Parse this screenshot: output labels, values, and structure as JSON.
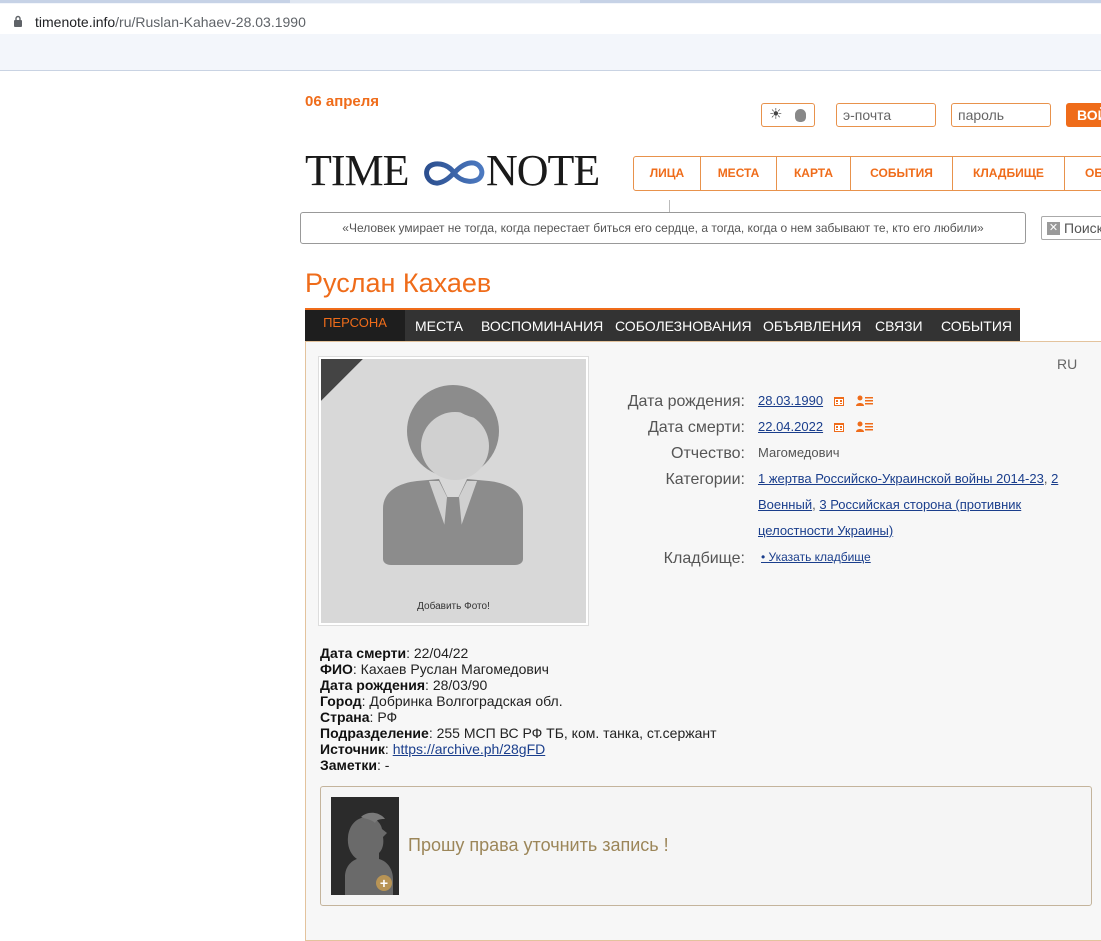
{
  "browser": {
    "url_host": "timenote.info",
    "url_path": "/ru/Ruslan-Kahaev-28.03.1990"
  },
  "header": {
    "date_today": "06 апреля",
    "email_placeholder": "э-почта",
    "password_placeholder": "пароль",
    "login_label": "ВОЙ",
    "logo_left": "TIME",
    "logo_right": "NOTE",
    "search_text": "Поиск"
  },
  "nav": {
    "items": [
      {
        "label": "ЛИЦА"
      },
      {
        "label": "МЕСТА"
      },
      {
        "label": "КАРТА"
      },
      {
        "label": "СОБЫТИЯ"
      },
      {
        "label": "КЛАДБИЩЕ"
      },
      {
        "label": "ОБ"
      }
    ]
  },
  "quote": "«Человек умирает не тогда, когда перестает биться его сердце, а тогда, когда о нем забывают те, кто его любили»",
  "person": {
    "name": "Руслан Кахаев",
    "lang": "RU",
    "add_photo": "Добавить Фото!"
  },
  "tabs": [
    {
      "label": "ПЕРСОНА",
      "active": true
    },
    {
      "label": "МЕСТА"
    },
    {
      "label": "ВОСПОМИНАНИЯ"
    },
    {
      "label": "СОБОЛЕЗНОВАНИЯ"
    },
    {
      "label": "ОБЪЯВЛЕНИЯ"
    },
    {
      "label": "СВЯЗИ"
    },
    {
      "label": "СОБЫТИЯ"
    }
  ],
  "info": {
    "birth_label": "Дата рождения:",
    "birth_value": "28.03.1990",
    "death_label": "Дата смерти:",
    "death_value": "22.04.2022",
    "patronymic_label": "Отчество:",
    "patronymic_value": "Магомедович",
    "categories_label": "Категории:",
    "categories_line1": "1 жертва Российско-Украинской войны 2014-23",
    "categories_line1_sep": ",",
    "categories_line1_tail": "2",
    "categories_line2a": "Военный",
    "categories_line2_sep": ",",
    "categories_line2b": "3 Российская сторона (противник",
    "categories_line3": "целостности Украины)",
    "cemetery_label": "Кладбище:",
    "cemetery_value": "• Указать кладбище"
  },
  "details": {
    "death_label": "Дата смерти",
    "death_value": ": 22/04/22",
    "fio_label": "ФИО",
    "fio_value": ": Кахаев Руслан Магомедович",
    "birth_label": "Дата рождения",
    "birth_value": ": 28/03/90",
    "city_label": "Город",
    "city_value": ": Добринка Волгоградская обл.",
    "country_label": "Страна",
    "country_value": ": РФ",
    "unit_label": "Подразделение",
    "unit_value": ": 255 МСП ВС РФ ТБ, ком. танка, ст.сержант",
    "source_label": "Источник",
    "source_sep": ": ",
    "source_link": "https://archive.ph/28gFD",
    "notes_label": "Заметки",
    "notes_value": ": -"
  },
  "request": {
    "text": "Прошу права уточнить запись !",
    "plus": "+"
  },
  "colors": {
    "accent": "#ef6c1a",
    "tab_bar": "#333333",
    "link": "#1a3e8c"
  }
}
